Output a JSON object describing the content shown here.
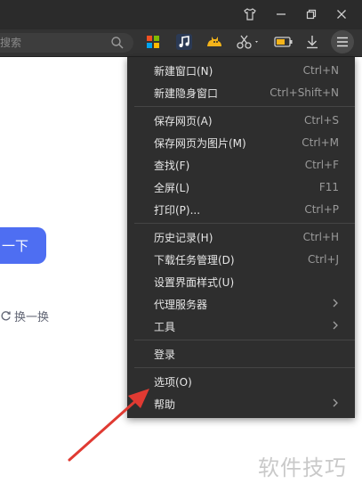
{
  "search": {
    "placeholder": "搜索"
  },
  "content": {
    "button_label": "一下",
    "refresh_label": "换一换"
  },
  "menu": {
    "items": [
      {
        "label": "新建窗口(N)",
        "shortcut": "Ctrl+N"
      },
      {
        "label": "新建隐身窗口",
        "shortcut": "Ctrl+Shift+N"
      },
      {
        "label": "保存网页(A)",
        "shortcut": "Ctrl+S"
      },
      {
        "label": "保存网页为图片(M)",
        "shortcut": "Ctrl+M"
      },
      {
        "label": "查找(F)",
        "shortcut": "Ctrl+F"
      },
      {
        "label": "全屏(L)",
        "shortcut": "F11"
      },
      {
        "label": "打印(P)...",
        "shortcut": "Ctrl+P"
      },
      {
        "label": "历史记录(H)",
        "shortcut": "Ctrl+H"
      },
      {
        "label": "下载任务管理(D)",
        "shortcut": "Ctrl+J"
      },
      {
        "label": "设置界面样式(U)",
        "shortcut": ""
      },
      {
        "label": "代理服务器",
        "shortcut": ""
      },
      {
        "label": "工具",
        "shortcut": ""
      },
      {
        "label": "登录",
        "shortcut": ""
      },
      {
        "label": "选项(O)",
        "shortcut": ""
      },
      {
        "label": "帮助",
        "shortcut": ""
      }
    ]
  },
  "watermark": "软件技巧",
  "colors": {
    "menu_bg": "#2e2e2e",
    "toolbar_bg": "#333333",
    "button_blue": "#4e6ef2",
    "arrow_red": "#e03a32"
  }
}
